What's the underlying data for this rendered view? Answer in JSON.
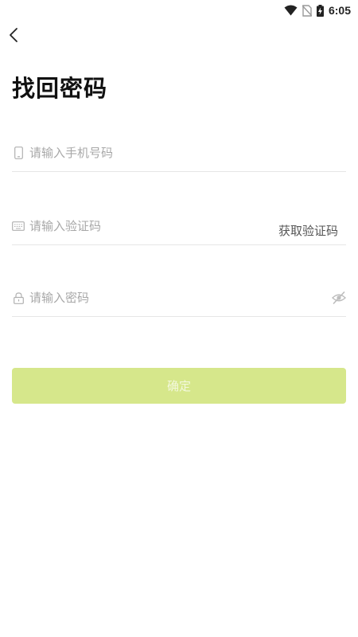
{
  "status_bar": {
    "time": "6:05",
    "icons": [
      "wifi-icon",
      "no-sim-icon",
      "battery-charging-icon"
    ]
  },
  "header": {
    "back_icon": "chevron-left-icon",
    "title": "找回密码"
  },
  "form": {
    "phone": {
      "icon": "phone-icon",
      "placeholder": "请输入手机号码",
      "value": ""
    },
    "code": {
      "icon": "keyboard-icon",
      "placeholder": "请输入验证码",
      "value": "",
      "get_code_label": "获取验证码"
    },
    "password": {
      "icon": "lock-icon",
      "placeholder": "请输入密码",
      "value": "",
      "toggle_icon": "eye-off-icon"
    },
    "confirm_label": "确定"
  },
  "colors": {
    "confirm_button": "#d6e78b",
    "confirm_text": "#f3f8dd",
    "placeholder": "#a8a8a8",
    "divider": "#e6e6e6"
  }
}
